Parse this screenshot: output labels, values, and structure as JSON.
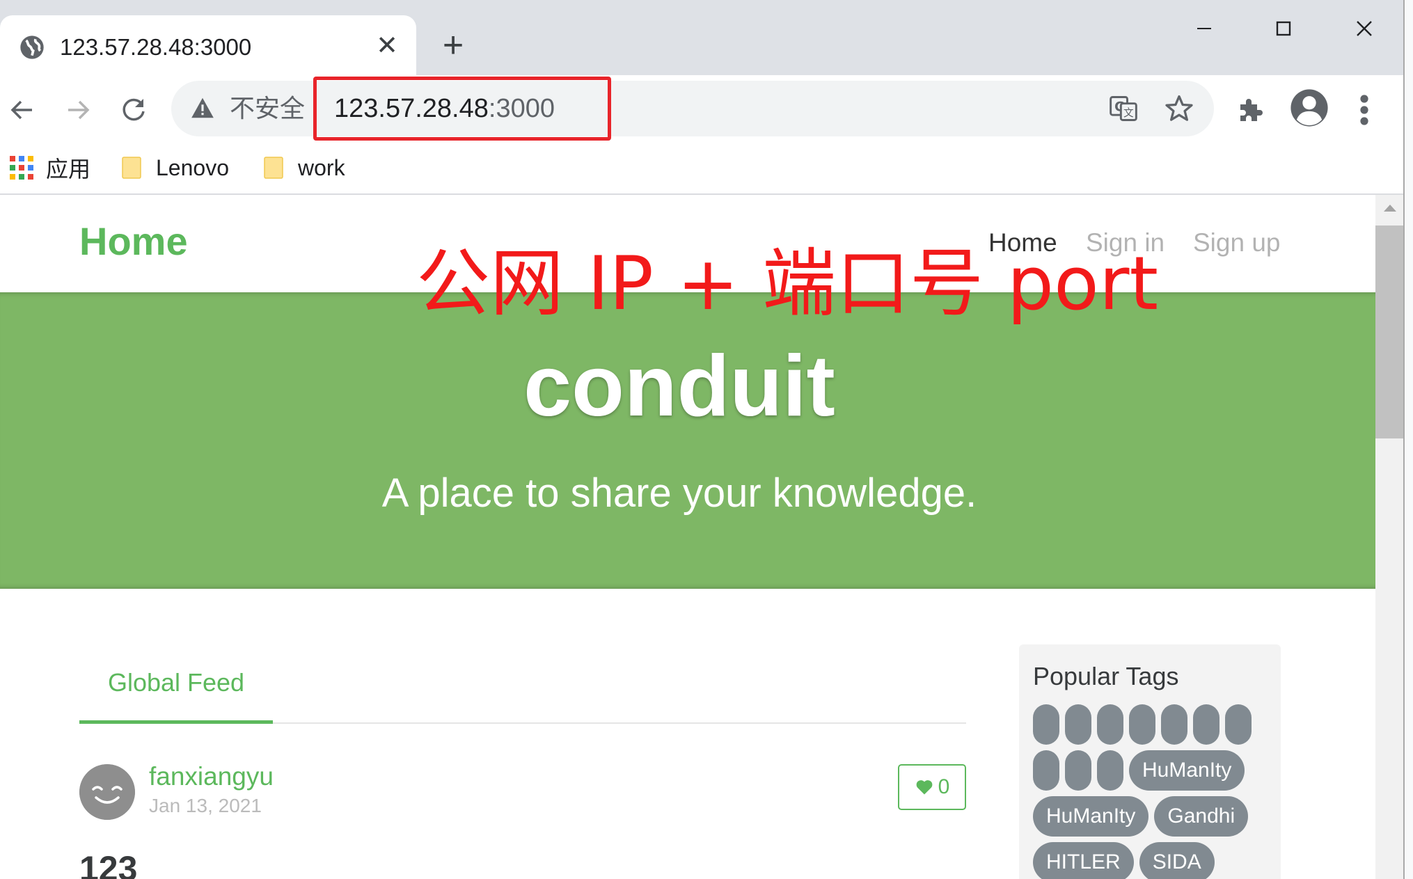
{
  "browser": {
    "tab_title": "123.57.28.48:3000",
    "insecure_label": "不安全",
    "url_host": "123.57.28.48",
    "url_port": ":3000",
    "bookmarks": [
      {
        "label": "应用",
        "icon": "apps-icon"
      },
      {
        "label": "Lenovo",
        "icon": "folder-icon"
      },
      {
        "label": "work",
        "icon": "folder-icon"
      }
    ]
  },
  "annotation": "公网 IP + 端口号 port",
  "site": {
    "brand": "Home",
    "nav": [
      {
        "label": "Home",
        "active": true
      },
      {
        "label": "Sign in",
        "active": false
      },
      {
        "label": "Sign up",
        "active": false
      }
    ]
  },
  "banner": {
    "title": "conduit",
    "subtitle": "A place to share your knowledge."
  },
  "feed": {
    "tabs": [
      "Global Feed"
    ],
    "articles": [
      {
        "author": "fanxiangyu",
        "date": "Jan 13, 2021",
        "favorites": "0",
        "title": "123"
      }
    ]
  },
  "sidebar": {
    "title": "Popular Tags",
    "tags": [
      "",
      "",
      "",
      "",
      "",
      "",
      "",
      "",
      "",
      "",
      "HuManIty",
      "HuManIty",
      "Gandhi",
      "HITLER",
      "SIDA"
    ]
  },
  "colors": {
    "brand_green": "#5cb85c",
    "banner_green": "#7eb765",
    "annotation_red": "#f21a1a",
    "tag_gray": "#818a91"
  }
}
